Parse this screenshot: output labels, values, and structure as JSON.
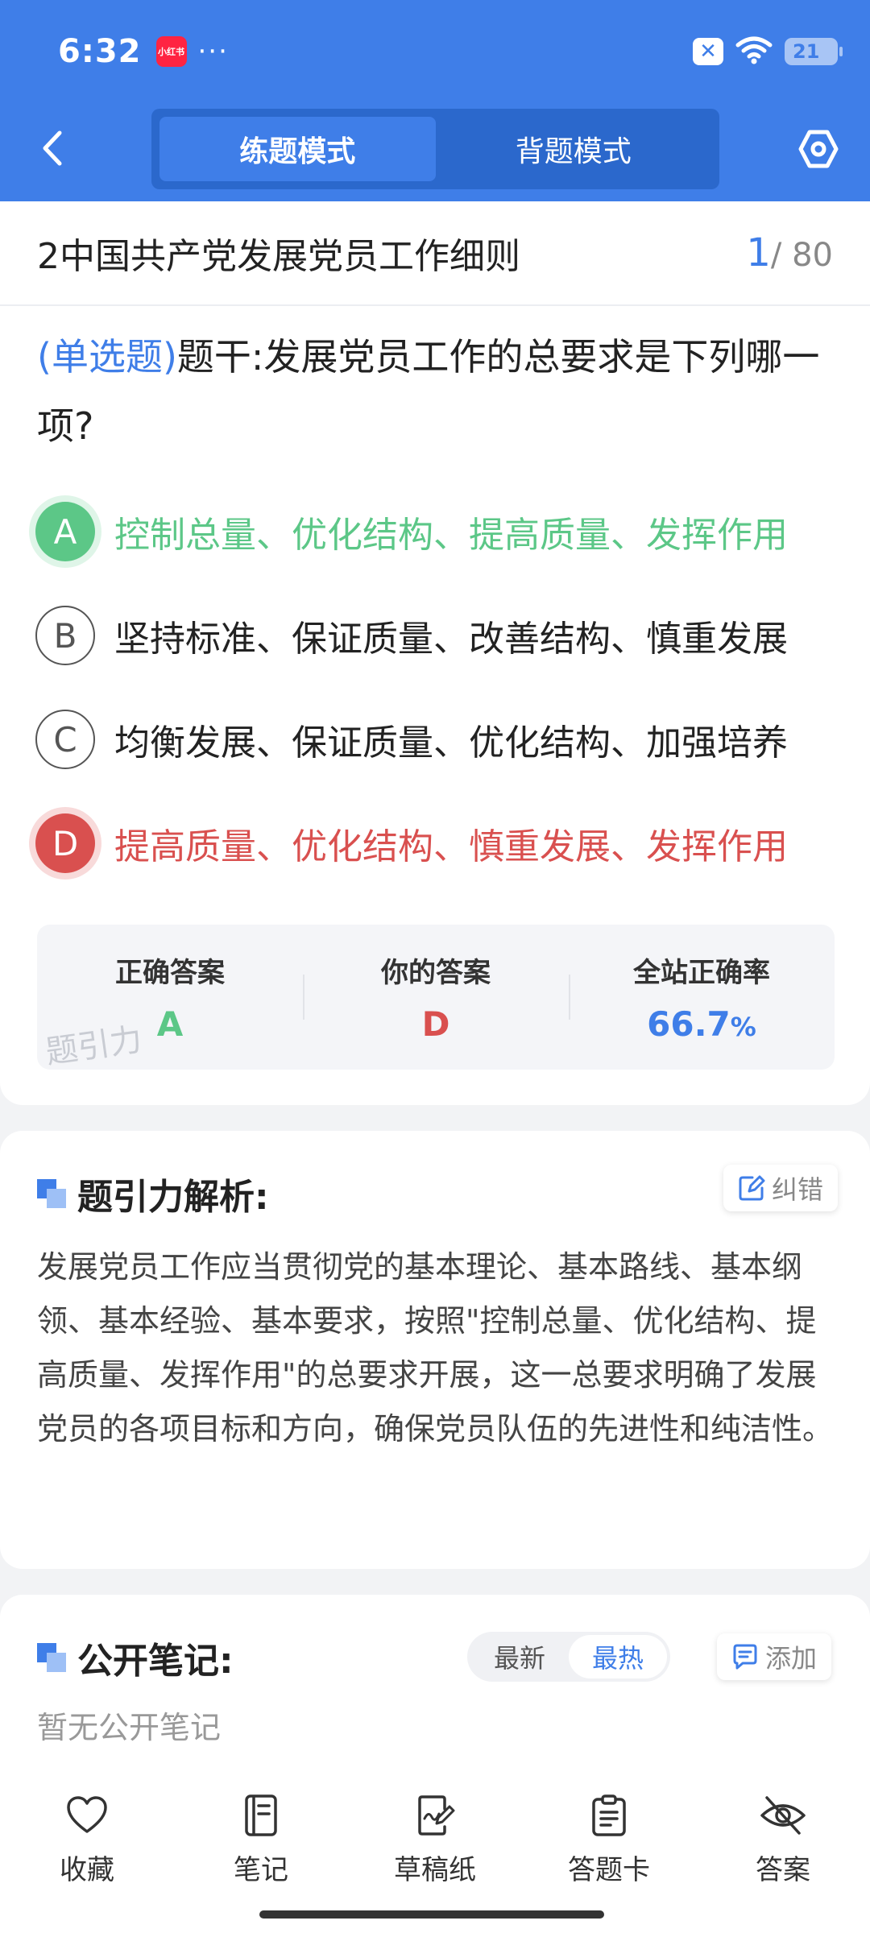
{
  "status_bar": {
    "time": "6:32",
    "app_badge": "小红书",
    "more": "···",
    "battery": "21"
  },
  "nav": {
    "tabs": [
      {
        "label": "练题模式",
        "active": true
      },
      {
        "label": "背题模式",
        "active": false
      }
    ]
  },
  "question_header": {
    "chapter": "2中国共产党发展党员工作细则",
    "current": "1",
    "total": "/ 80"
  },
  "question": {
    "type_label": "(单选题)",
    "text": "题干:发展党员工作的总要求是下列哪一项?"
  },
  "options": [
    {
      "letter": "A",
      "text": "控制总量、优化结构、提高质量、发挥作用",
      "state": "correct"
    },
    {
      "letter": "B",
      "text": "坚持标准、保证质量、改善结构、慎重发展",
      "state": "normal"
    },
    {
      "letter": "C",
      "text": "均衡发展、保证质量、优化结构、加强培养",
      "state": "normal"
    },
    {
      "letter": "D",
      "text": "提高质量、优化结构、慎重发展、发挥作用",
      "state": "wrong"
    }
  ],
  "answer_summary": {
    "correct_label": "正确答案",
    "correct_value": "A",
    "yours_label": "你的答案",
    "yours_value": "D",
    "rate_label": "全站正确率",
    "rate_value": "66.7",
    "rate_unit": "%",
    "watermark": "题引力"
  },
  "analysis": {
    "title": "题引力解析:",
    "report_button": "纠错",
    "text": "发展党员工作应当贯彻党的基本理论、基本路线、基本纲领、基本经验、基本要求，按照\"控制总量、优化结构、提高质量、发挥作用\"的总要求开展，这一总要求明确了发展党员的各项目标和方向，确保党员队伍的先进性和纯洁性。"
  },
  "notes": {
    "title": "公开笔记:",
    "sort_options": [
      {
        "label": "最新",
        "active": false
      },
      {
        "label": "最热",
        "active": true
      }
    ],
    "add_button": "添加",
    "empty_text": "暂无公开笔记"
  },
  "bottom_bar": [
    {
      "label": "收藏",
      "icon": "heart-icon"
    },
    {
      "label": "笔记",
      "icon": "notebook-icon"
    },
    {
      "label": "草稿纸",
      "icon": "draft-icon"
    },
    {
      "label": "答题卡",
      "icon": "answer-sheet-icon"
    },
    {
      "label": "答案",
      "icon": "eye-off-icon"
    }
  ],
  "colors": {
    "primary": "#3f7ee8",
    "correct": "#5cc787",
    "wrong": "#d9504f"
  }
}
